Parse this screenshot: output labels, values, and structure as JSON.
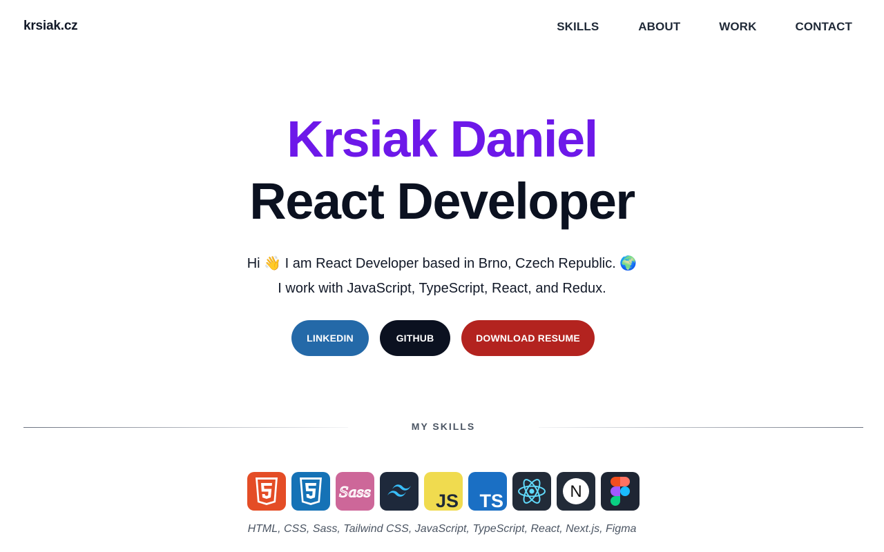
{
  "nav": {
    "brand": "krsiak.cz",
    "links": [
      "SKILLS",
      "ABOUT",
      "WORK",
      "CONTACT"
    ]
  },
  "hero": {
    "name": "Krsiak Daniel",
    "role": "React Developer",
    "intro_before": "Hi",
    "intro_wave": "👋",
    "intro_after": "I am React Developer based in Brno, Czech Republic.",
    "intro_globe": "🌍",
    "intro_line2": "I work with JavaScript, TypeScript, React, and Redux."
  },
  "buttons": {
    "linkedin": "LINKEDIN",
    "github": "GITHUB",
    "resume": "DOWNLOAD RESUME"
  },
  "skills": {
    "title": "MY SKILLS",
    "icons": [
      "html5-icon",
      "css3-icon",
      "sass-icon",
      "tailwind-icon",
      "javascript-icon",
      "typescript-icon",
      "react-icon",
      "nextjs-icon",
      "figma-icon"
    ],
    "icon_text": {
      "sass": "Sass",
      "js": "JS",
      "ts": "TS",
      "next": "N"
    },
    "list": "HTML, CSS, Sass, Tailwind CSS, JavaScript, TypeScript, React, Next.js, Figma"
  },
  "colors": {
    "accent": "#6d18e9",
    "linkedin": "#2469a8",
    "github": "#0b1120",
    "resume": "#b3231f"
  }
}
